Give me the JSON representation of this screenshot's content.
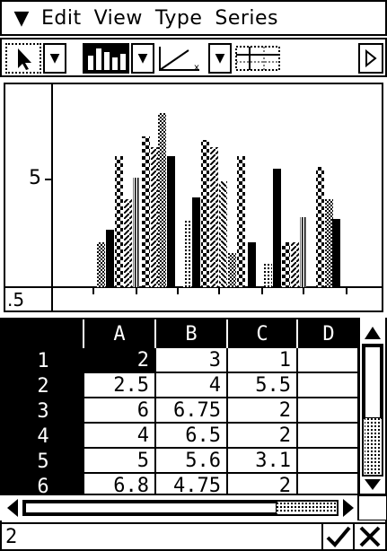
{
  "menu": {
    "icon": "menu-chevron-icon",
    "items": [
      "Edit",
      "View",
      "Type",
      "Series"
    ]
  },
  "toolbar": {
    "tools": [
      "select-arrow-icon",
      "bar-graph-icon",
      "xy-line-graph-icon",
      "table-grid-icon"
    ],
    "scroll_icon": "toolbar-scroll-right-icon"
  },
  "graph": {
    "y_tick_label": "5",
    "x_tick_label": ".5"
  },
  "sheet": {
    "columns": [
      "A",
      "B",
      "C",
      "D"
    ],
    "rows": [
      {
        "label": "1",
        "cells": [
          "2",
          "3",
          "1",
          ""
        ]
      },
      {
        "label": "2",
        "cells": [
          "2.5",
          "4",
          "5.5",
          ""
        ]
      },
      {
        "label": "3",
        "cells": [
          "6",
          "6.75",
          "2",
          ""
        ]
      },
      {
        "label": "4",
        "cells": [
          "4",
          "6.5",
          "2",
          ""
        ]
      },
      {
        "label": "5",
        "cells": [
          "5",
          "5.6",
          "3.1",
          ""
        ]
      },
      {
        "label": "6",
        "cells": [
          "6.8",
          "4.75",
          "2",
          ""
        ]
      }
    ],
    "selected_cell": "A1"
  },
  "entry": {
    "value": "2",
    "confirm_icon": "checkmark-icon",
    "cancel_icon": "close-icon"
  },
  "colors": {
    "foreground": "#000000",
    "background": "#ffffff"
  }
}
